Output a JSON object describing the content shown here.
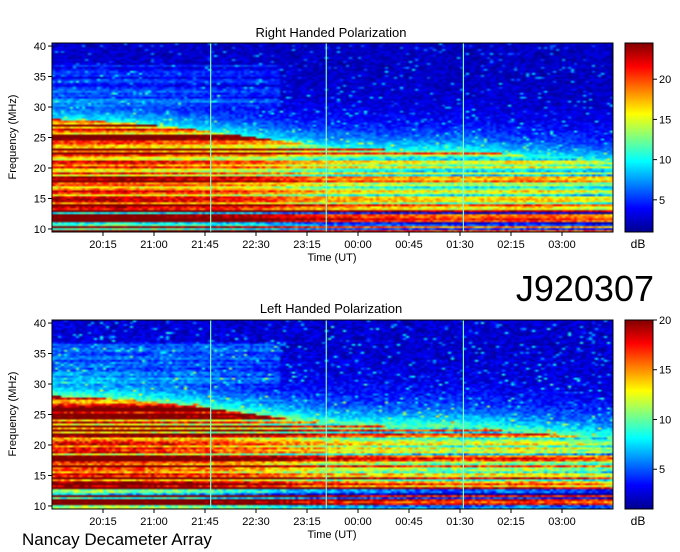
{
  "figure": {
    "id_label": "J920307",
    "footer": "Nancay Decameter Array"
  },
  "colormap": [
    "#00008f",
    "#0000ff",
    "#0080ff",
    "#00ffff",
    "#80ff80",
    "#ffff00",
    "#ff8000",
    "#ff0000",
    "#800000"
  ],
  "chart_data": [
    {
      "type": "heatmap",
      "title": "Right Handed Polarization",
      "xlabel": "Time (UT)",
      "ylabel": "Frequency (MHz)",
      "x_ticks": [
        "20:15",
        "21:00",
        "21:45",
        "22:30",
        "23:15",
        "00:00",
        "00:45",
        "01:30",
        "02:15",
        "03:00"
      ],
      "x_range": [
        "19:30",
        "03:45"
      ],
      "y_ticks": [
        10,
        15,
        20,
        25,
        30,
        35,
        40
      ],
      "ylim": [
        9.5,
        40.5
      ],
      "colorbar": {
        "label": "dB",
        "ticks": [
          5,
          10,
          15,
          20
        ],
        "range": [
          1,
          24.5
        ]
      },
      "vertical_lines_ut": [
        "21:50",
        "23:32",
        "01:33"
      ],
      "emission_profile": {
        "time_ut": [
          "19:30",
          "20:30",
          "21:30",
          "22:30",
          "23:30",
          "00:30",
          "01:30",
          "02:30",
          "03:45"
        ],
        "upper_frequency_mhz": [
          28,
          27.5,
          26.5,
          25,
          23.5,
          23,
          23,
          22,
          21
        ],
        "core_level_db": [
          21,
          21,
          20,
          19,
          16,
          15,
          14,
          15,
          13
        ]
      }
    },
    {
      "type": "heatmap",
      "title": "Left Handed Polarization",
      "xlabel": "Time (UT)",
      "ylabel": "Frequency (MHz)",
      "x_ticks": [
        "20:15",
        "21:00",
        "21:45",
        "22:30",
        "23:15",
        "00:00",
        "00:45",
        "01:30",
        "02:15",
        "03:00"
      ],
      "x_range": [
        "19:30",
        "03:45"
      ],
      "y_ticks": [
        10,
        15,
        20,
        25,
        30,
        35,
        40
      ],
      "ylim": [
        9.5,
        40.5
      ],
      "colorbar": {
        "label": "dB",
        "ticks": [
          5,
          10,
          15,
          20
        ],
        "range": [
          1,
          20
        ]
      },
      "vertical_lines_ut": [
        "21:50",
        "23:32",
        "01:33"
      ],
      "emission_profile": {
        "time_ut": [
          "19:30",
          "20:30",
          "21:30",
          "22:30",
          "23:30",
          "00:30",
          "01:30",
          "02:30",
          "03:45"
        ],
        "upper_frequency_mhz": [
          28,
          27.5,
          26.5,
          25,
          23.5,
          23,
          23,
          22,
          21
        ],
        "core_level_db": [
          18,
          18,
          17,
          16,
          14,
          13,
          12,
          13,
          11
        ]
      }
    }
  ]
}
